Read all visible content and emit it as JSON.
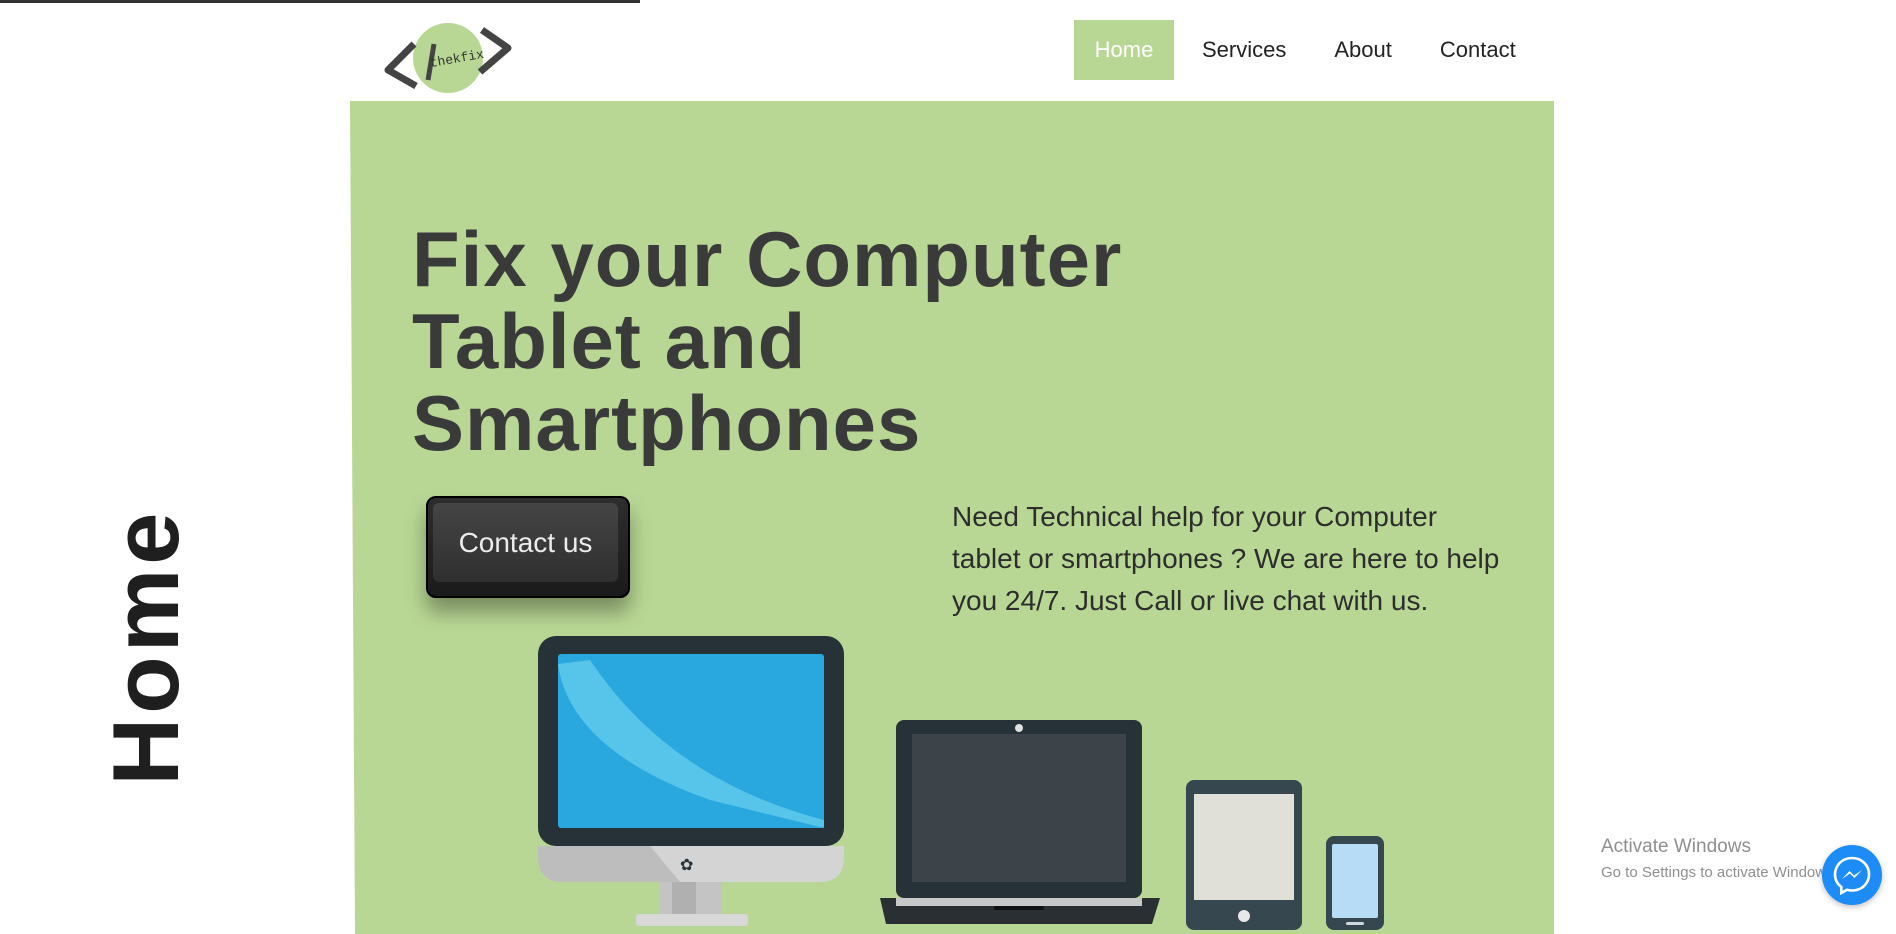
{
  "logo": {
    "text": "thekfix",
    "icon": "code-brackets-logo"
  },
  "nav": {
    "items": [
      {
        "label": "Home",
        "active": true
      },
      {
        "label": "Services",
        "active": false
      },
      {
        "label": "About",
        "active": false
      },
      {
        "label": "Contact",
        "active": false
      }
    ]
  },
  "hero": {
    "title_lines": [
      "Fix your Computer",
      "Tablet and",
      "Smartphones"
    ],
    "cta_label": "Contact us",
    "description": "Need Technical help for your Computer tablet or smartphones ? We are here to help you 24/7. Just Call or live chat with us.",
    "illustration": [
      "desktop-monitor-icon",
      "laptop-icon",
      "tablet-icon",
      "smartphone-icon"
    ]
  },
  "side_label": "Home",
  "watermark": {
    "title": "Activate Windows",
    "subtitle": "Go to Settings to activate Windows."
  },
  "chat": {
    "icon": "messenger-icon"
  },
  "colors": {
    "accent": "#b9d794",
    "text_dark": "#3a3a3a",
    "button_dark": "#2e2e2e",
    "messenger_blue": "#1e8cf7",
    "screen_blue": "#29a8e0"
  }
}
